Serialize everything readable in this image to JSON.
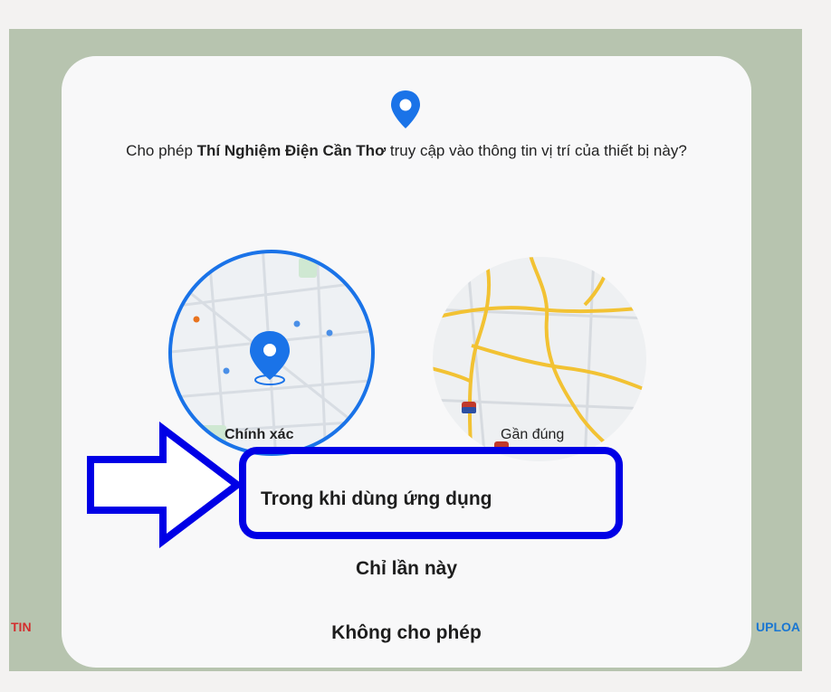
{
  "dialog": {
    "prompt_prefix": "Cho phép ",
    "app_name": "Thí Nghiệm Điện Cần Thơ",
    "prompt_suffix": " truy cập vào thông tin vị trí của thiết bị này?",
    "precise_label": "Chính xác",
    "approximate_label": "Gần đúng",
    "options": [
      "Trong khi dùng ứng dụng",
      "Chỉ lần này",
      "Không cho phép"
    ],
    "accent_color": "#1a73e8",
    "highlight_color": "#0000e6"
  },
  "background": {
    "left_text": "TIN",
    "right_text": "UPLOA"
  }
}
